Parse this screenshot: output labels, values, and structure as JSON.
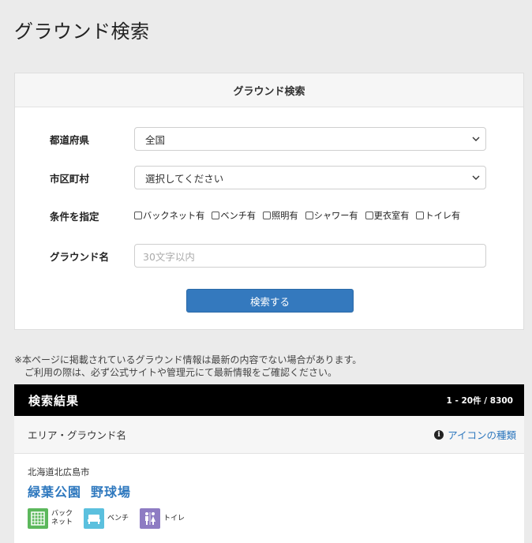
{
  "page": {
    "title": "グラウンド検索"
  },
  "search_panel": {
    "header": "グラウンド検索",
    "prefecture": {
      "label": "都道府県",
      "value": "全国"
    },
    "city": {
      "label": "市区町村",
      "value": "選択してください"
    },
    "conditions": {
      "label": "条件を指定",
      "options": [
        {
          "label": "バックネット有",
          "checked": false
        },
        {
          "label": "ベンチ有",
          "checked": false
        },
        {
          "label": "照明有",
          "checked": false
        },
        {
          "label": "シャワー有",
          "checked": false
        },
        {
          "label": "更衣室有",
          "checked": false
        },
        {
          "label": "トイレ有",
          "checked": false
        }
      ]
    },
    "ground_name": {
      "label": "グラウンド名",
      "placeholder": "30文字以内",
      "value": ""
    },
    "submit_label": "検索する"
  },
  "notice": {
    "line1": "※本ページに掲載されているグラウンド情報は最新の内容でない場合があります。",
    "line2": "ご利用の際は、必ず公式サイトや管理元にて最新情報をご確認ください。"
  },
  "results": {
    "title": "検索結果",
    "count": "1 - 20件 / 8300",
    "column_title": "エリア・グラウンド名",
    "icon_types_link": "アイコンの種類",
    "items": [
      {
        "area": "北海道北広島市",
        "name_part1": "緑葉公園",
        "name_part2": "野球場",
        "facilities": [
          {
            "icon": "backnet-icon",
            "label": "バック\nネット",
            "color": "#5cb85c"
          },
          {
            "icon": "bench-icon",
            "label": "ベンチ",
            "color": "#5bc0de"
          },
          {
            "icon": "toilet-icon",
            "label": "トイレ",
            "color": "#8e7cc3"
          }
        ]
      }
    ]
  },
  "colors": {
    "accent": "#2e78be",
    "button": "#3479be",
    "header_bar": "#000000"
  }
}
